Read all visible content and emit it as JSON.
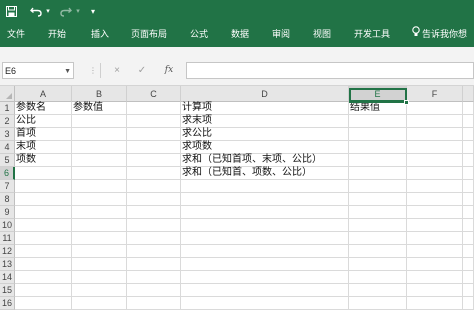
{
  "ribbon": {
    "tabs": [
      "文件",
      "开始",
      "插入",
      "页面布局",
      "公式",
      "数据",
      "审阅",
      "视图",
      "开发工具"
    ],
    "tell_me": "告诉我你想"
  },
  "formula_bar": {
    "name_box": "E6",
    "cancel_symbol": "×",
    "confirm_symbol": "✓",
    "function_symbol": "fx",
    "formula": ""
  },
  "sheet": {
    "columns": [
      "A",
      "B",
      "C",
      "D",
      "E",
      "F"
    ],
    "rows": [
      "1",
      "2",
      "3",
      "4",
      "5",
      "6",
      "7",
      "8",
      "9",
      "10",
      "11",
      "12",
      "13",
      "14",
      "15",
      "16"
    ],
    "active_cell": "E6",
    "cells": {
      "A1": "参数名",
      "B1": "参数值",
      "D1": "计算项",
      "E1": "结果值",
      "A2": "公比",
      "D2": "求末项",
      "A3": "首项",
      "D3": "求公比",
      "A4": "末项",
      "D4": "求项数",
      "A5": "项数",
      "D5": "求和（已知首项、末项、公比）",
      "D6": "求和（已知首、项数、公比）"
    }
  }
}
